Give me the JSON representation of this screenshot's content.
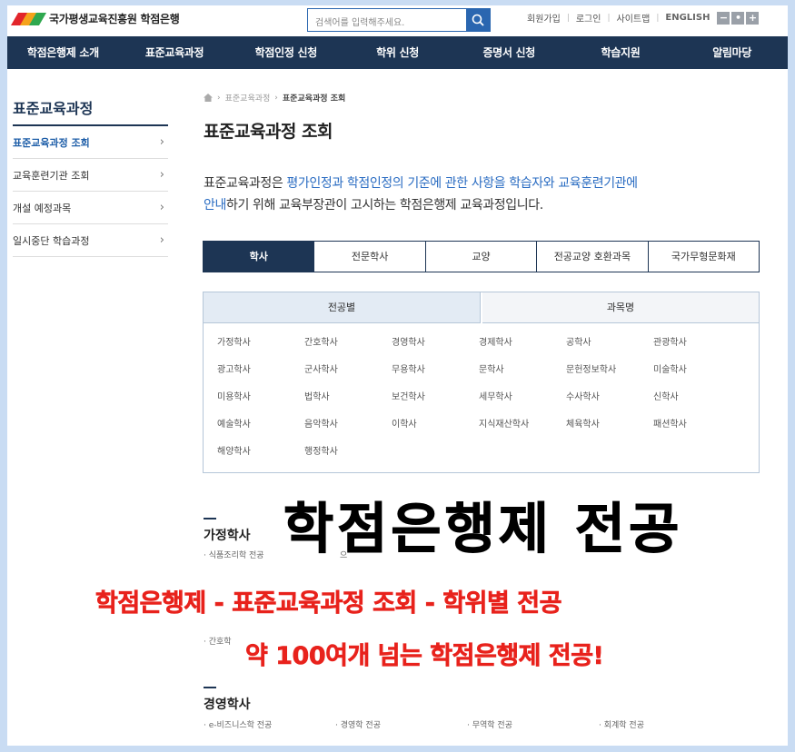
{
  "header": {
    "logo_text": "국가평생교육진흥원 학점은행",
    "search_placeholder": "검색어를 입력해주세요.",
    "utility": [
      "회원가입",
      "로그인",
      "사이트맵",
      "ENGLISH"
    ],
    "zoom": [
      "−",
      "•",
      "+"
    ]
  },
  "nav": [
    "학점은행제 소개",
    "표준교육과정",
    "학점인정 신청",
    "학위 신청",
    "증명서 신청",
    "학습지원",
    "알림마당"
  ],
  "sidebar": {
    "title": "표준교육과정",
    "items": [
      {
        "label": "표준교육과정 조회",
        "active": true
      },
      {
        "label": "교육훈련기관 조회",
        "active": false
      },
      {
        "label": "개설 예정과목",
        "active": false
      },
      {
        "label": "일시중단 학습과정",
        "active": false
      }
    ]
  },
  "breadcrumb": {
    "level1": "표준교육과정",
    "current": "표준교육과정 조회"
  },
  "page_title": "표준교육과정 조회",
  "description": {
    "p1": "표준교육과정은 ",
    "h1": "평가인정과 학점인정의 기준에 관한 사항을 학습자와 교육훈련기관에",
    "h2": "안내",
    "p2": "하기 위해 교육부장관이 고시하는 학점은행제 교육과정입니다."
  },
  "tabs": [
    "학사",
    "전문학사",
    "교양",
    "전공교양 호환과목",
    "국가무형문화재"
  ],
  "subtabs": [
    "전공별",
    "과목명"
  ],
  "majors": [
    "가정학사",
    "간호학사",
    "경영학사",
    "경제학사",
    "공학사",
    "관광학사",
    "광고학사",
    "군사학사",
    "무용학사",
    "문학사",
    "문헌정보학사",
    "미술학사",
    "미용학사",
    "법학사",
    "보건학사",
    "세무학사",
    "수사학사",
    "신학사",
    "예술학사",
    "음악학사",
    "이학사",
    "지식재산학사",
    "체육학사",
    "패션학사",
    "해양학사",
    "행정학사"
  ],
  "sections": [
    {
      "title": "가정학사",
      "items": [
        "식품조리학 전공",
        "으"
      ]
    },
    {
      "title": "",
      "items": [
        "간호학"
      ]
    },
    {
      "title": "경영학사",
      "items": [
        "e-비즈니스학 전공",
        "경영학 전공",
        "무역학 전공",
        "회계학 전공"
      ]
    }
  ],
  "overlay": {
    "headline": "학점은행제 전공",
    "line1": "학점은행제 - 표준교육과정 조회 - 학위별 전공",
    "line2": "약 100여개 넘는 학점은행제 전공!"
  },
  "colors": {
    "navy": "#1d3554",
    "accent_blue": "#2a6cc2",
    "overlay_red": "#e8221c",
    "frame_bg": "#c9dcf3"
  }
}
